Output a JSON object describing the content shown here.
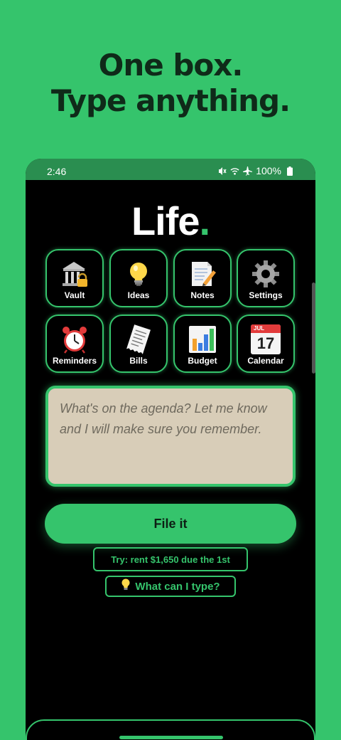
{
  "headline": {
    "line1": "One box.",
    "line2": "Type anything."
  },
  "status_bar": {
    "time": "2:46",
    "battery": "100%",
    "icons": [
      "mute-icon",
      "wifi-icon",
      "airplane-icon",
      "battery-icon"
    ]
  },
  "logo": {
    "text": "Life",
    "dot": "."
  },
  "tiles": [
    {
      "label": "Vault",
      "icon": "bank-lock-icon"
    },
    {
      "label": "Ideas",
      "icon": "lightbulb-icon"
    },
    {
      "label": "Notes",
      "icon": "memo-icon"
    },
    {
      "label": "Settings",
      "icon": "gear-icon"
    },
    {
      "label": "Reminders",
      "icon": "alarm-clock-icon"
    },
    {
      "label": "Bills",
      "icon": "receipt-icon"
    },
    {
      "label": "Budget",
      "icon": "bar-chart-icon"
    },
    {
      "label": "Calendar",
      "icon": "calendar-icon"
    }
  ],
  "calendar_icon": {
    "month": "JUL",
    "day": "17"
  },
  "input": {
    "placeholder": "What's on the agenda? Let me know and I will make sure you remember.",
    "value": ""
  },
  "file_button": {
    "label": "File it"
  },
  "try_hint": {
    "label": "Try: rent $1,650 due the 1st"
  },
  "help_button": {
    "label": "What can I type?",
    "icon": "lightbulb-icon"
  },
  "colors": {
    "brand_green": "#35c46c",
    "status_green": "#2a8e50",
    "input_bg": "#d8cdb8"
  }
}
